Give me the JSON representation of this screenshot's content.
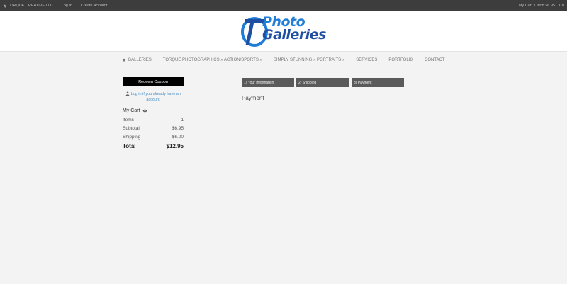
{
  "topbar": {
    "brand": "TORQUE CREATIVE LLC",
    "login": "Log In",
    "create_account": "Create Account",
    "cart_summary": "My Cart 1 item $6.95",
    "cut": "Ch"
  },
  "logo": {
    "line1": "Photo",
    "line2": "Galleries",
    "colors": {
      "blue": "#1f7dd6",
      "dark_blue": "#1e4fa3"
    }
  },
  "nav": {
    "galleries": "GALLERIES",
    "torque": "TORQUE PHOTOGRAPHICS » ACTION/SPORTS »",
    "simply": "SIMPLY STUNNING » PORTRAITS »",
    "services": "SERVICES",
    "portfolio": "PORTFOLIO",
    "contact": "CONTACT"
  },
  "sidebar": {
    "redeem_coupon": "Redeem Coupon",
    "login_prompt": "Log in if you already have an account",
    "cart_title": "My Cart",
    "rows": [
      {
        "label": "Items",
        "value": "1"
      },
      {
        "label": "Subtotal",
        "value": "$6.95"
      },
      {
        "label": "Shipping",
        "value": "$6.00"
      },
      {
        "label": "Total",
        "value": "$12.95"
      }
    ]
  },
  "steps": [
    "1) Your Information",
    "2) Shipping",
    "3) Payment"
  ],
  "main": {
    "heading": "Payment"
  }
}
